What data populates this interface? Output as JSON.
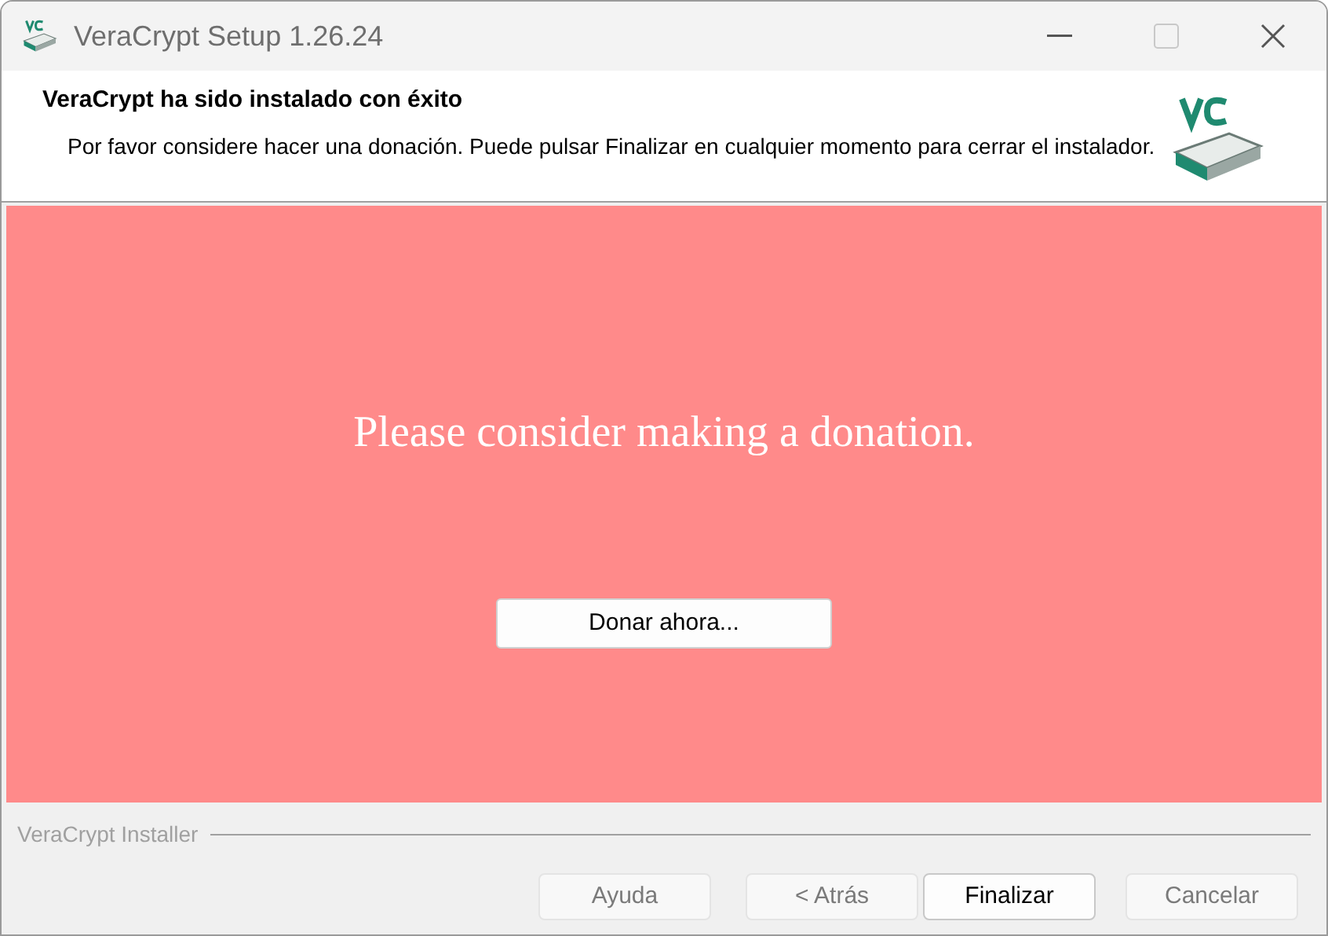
{
  "window": {
    "title": "VeraCrypt Setup 1.26.24",
    "maximize_disabled": true
  },
  "header": {
    "title": "VeraCrypt ha sido instalado con éxito",
    "description": "Por favor considere hacer una donación. Puede pulsar Finalizar en cualquier momento para cerrar el instalador."
  },
  "donation_panel": {
    "message": "Please consider making a donation.",
    "button": "Donar ahora..."
  },
  "footer": {
    "group_label": "VeraCrypt Installer"
  },
  "buttons": [
    {
      "label": "Ayuda",
      "disabled": true
    },
    {
      "label": "< Atrás",
      "disabled": true
    },
    {
      "label": "Finalizar",
      "disabled": false
    },
    {
      "label": "Cancelar",
      "disabled": true
    }
  ]
}
